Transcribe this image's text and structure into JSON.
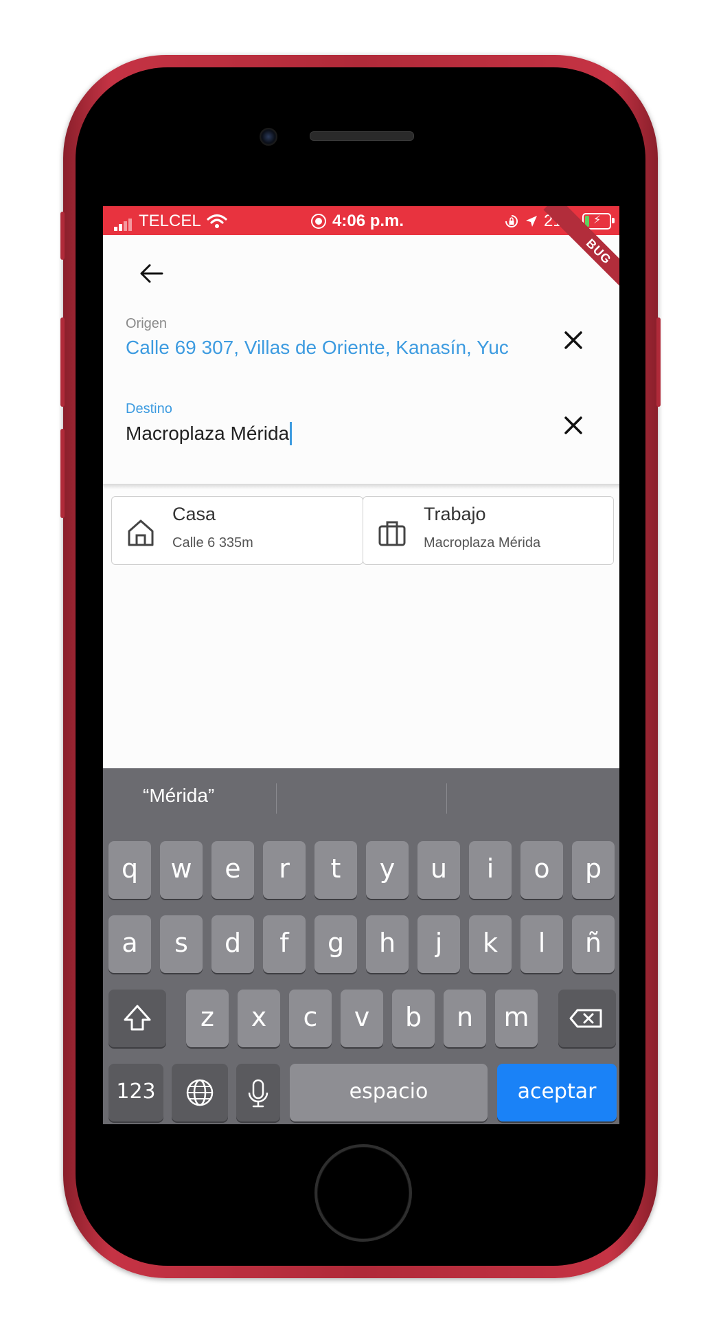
{
  "status_bar": {
    "carrier": "TELCEL",
    "time": "4:06 p.m.",
    "battery": "21%",
    "battery_level": 0.21
  },
  "debug_banner": "BUG",
  "form": {
    "origin_label": "Origen",
    "origin_value": "Calle 69 307, Villas de Oriente, Kanasín, Yuc",
    "destination_label": "Destino",
    "destination_value": "Macroplaza Mérida"
  },
  "shortcuts": [
    {
      "title": "Casa",
      "subtitle": "Calle 6 335m",
      "icon": "home-icon"
    },
    {
      "title": "Trabajo",
      "subtitle": "Macroplaza Mérida",
      "icon": "briefcase-icon"
    }
  ],
  "keyboard": {
    "suggestion": "“Mérida”",
    "row1": [
      "q",
      "w",
      "e",
      "r",
      "t",
      "y",
      "u",
      "i",
      "o",
      "p"
    ],
    "row2": [
      "a",
      "s",
      "d",
      "f",
      "g",
      "h",
      "j",
      "k",
      "l",
      "ñ"
    ],
    "row3": [
      "z",
      "x",
      "c",
      "v",
      "b",
      "n",
      "m"
    ],
    "numbers_key": "123",
    "space_key": "espacio",
    "return_key": "aceptar"
  },
  "colors": {
    "status_bar": "#e8333f",
    "accent": "#3d9be0",
    "keyboard_return": "#1a82f7",
    "phone_body": "#b02a39"
  }
}
